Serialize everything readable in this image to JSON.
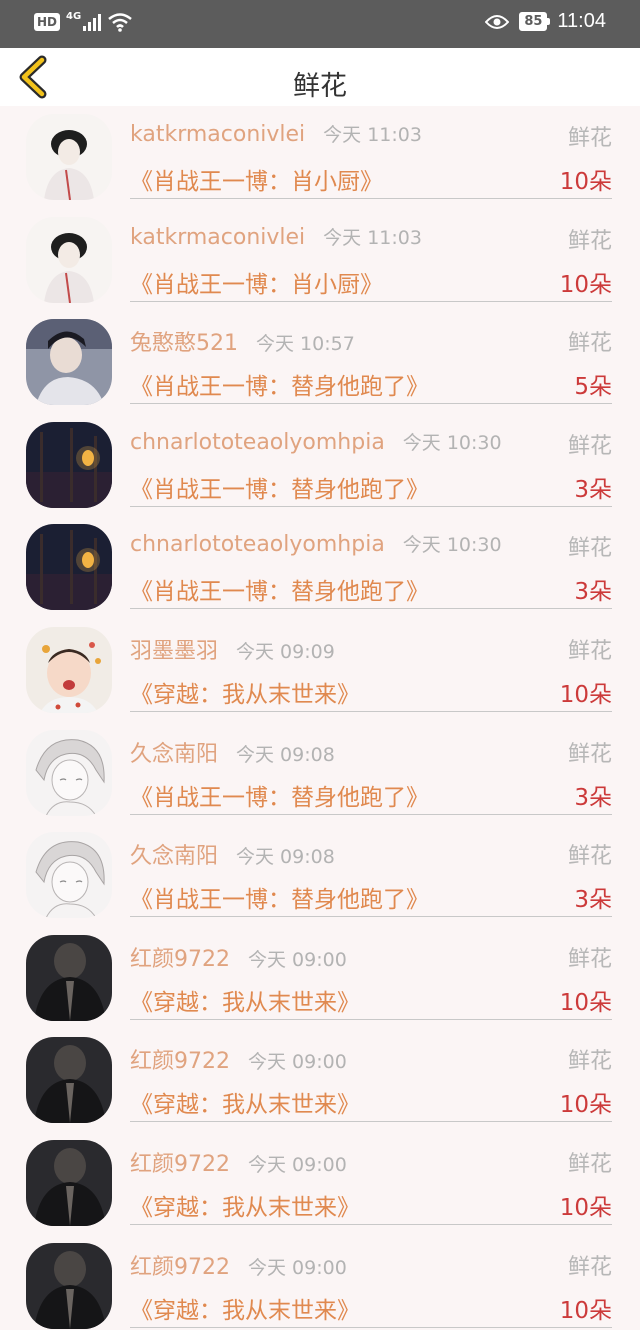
{
  "status_bar": {
    "hd": "HD",
    "network": "4G",
    "battery": "85",
    "time": "11:04"
  },
  "header": {
    "title": "鲜花"
  },
  "rows": [
    {
      "avatar": "avatar-sketch-boy",
      "name": "katkrmaconivlei",
      "time": "今天 11:03",
      "kind": "鲜花",
      "book": "《肖战王一博：肖小厨》",
      "count": "10朵"
    },
    {
      "avatar": "avatar-sketch-boy",
      "name": "katkrmaconivlei",
      "time": "今天 11:03",
      "kind": "鲜花",
      "book": "《肖战王一博：肖小厨》",
      "count": "10朵"
    },
    {
      "avatar": "avatar-photo-man",
      "name": "兔憨憨521",
      "time": "今天 10:57",
      "kind": "鲜花",
      "book": "《肖战王一博：替身他跑了》",
      "count": "5朵"
    },
    {
      "avatar": "avatar-night-lantern",
      "name": "chnarlototeaolyomhpia",
      "time": "今天 10:30",
      "kind": "鲜花",
      "book": "《肖战王一博：替身他跑了》",
      "count": "3朵"
    },
    {
      "avatar": "avatar-night-lantern",
      "name": "chnarlototeaolyomhpia",
      "time": "今天 10:30",
      "kind": "鲜花",
      "book": "《肖战王一博：替身他跑了》",
      "count": "3朵"
    },
    {
      "avatar": "avatar-baby",
      "name": "羽墨墨羽",
      "time": "今天 09:09",
      "kind": "鲜花",
      "book": "《穿越：我从末世来》",
      "count": "10朵"
    },
    {
      "avatar": "avatar-sketch-girl",
      "name": "久念南阳",
      "time": "今天 09:08",
      "kind": "鲜花",
      "book": "《肖战王一博：替身他跑了》",
      "count": "3朵"
    },
    {
      "avatar": "avatar-sketch-girl",
      "name": "久念南阳",
      "time": "今天 09:08",
      "kind": "鲜花",
      "book": "《肖战王一博：替身他跑了》",
      "count": "3朵"
    },
    {
      "avatar": "avatar-dark-person",
      "name": "红颜9722",
      "time": "今天 09:00",
      "kind": "鲜花",
      "book": "《穿越：我从末世来》",
      "count": "10朵"
    },
    {
      "avatar": "avatar-dark-person",
      "name": "红颜9722",
      "time": "今天 09:00",
      "kind": "鲜花",
      "book": "《穿越：我从末世来》",
      "count": "10朵"
    },
    {
      "avatar": "avatar-dark-person",
      "name": "红颜9722",
      "time": "今天 09:00",
      "kind": "鲜花",
      "book": "《穿越：我从末世来》",
      "count": "10朵"
    },
    {
      "avatar": "avatar-dark-person",
      "name": "红颜9722",
      "time": "今天 09:00",
      "kind": "鲜花",
      "book": "《穿越：我从末世来》",
      "count": "10朵"
    }
  ],
  "colors": {
    "name": "#e0a37f",
    "book": "#e0894f",
    "count": "#cc3a3a",
    "back_icon": "#f2c21b"
  }
}
